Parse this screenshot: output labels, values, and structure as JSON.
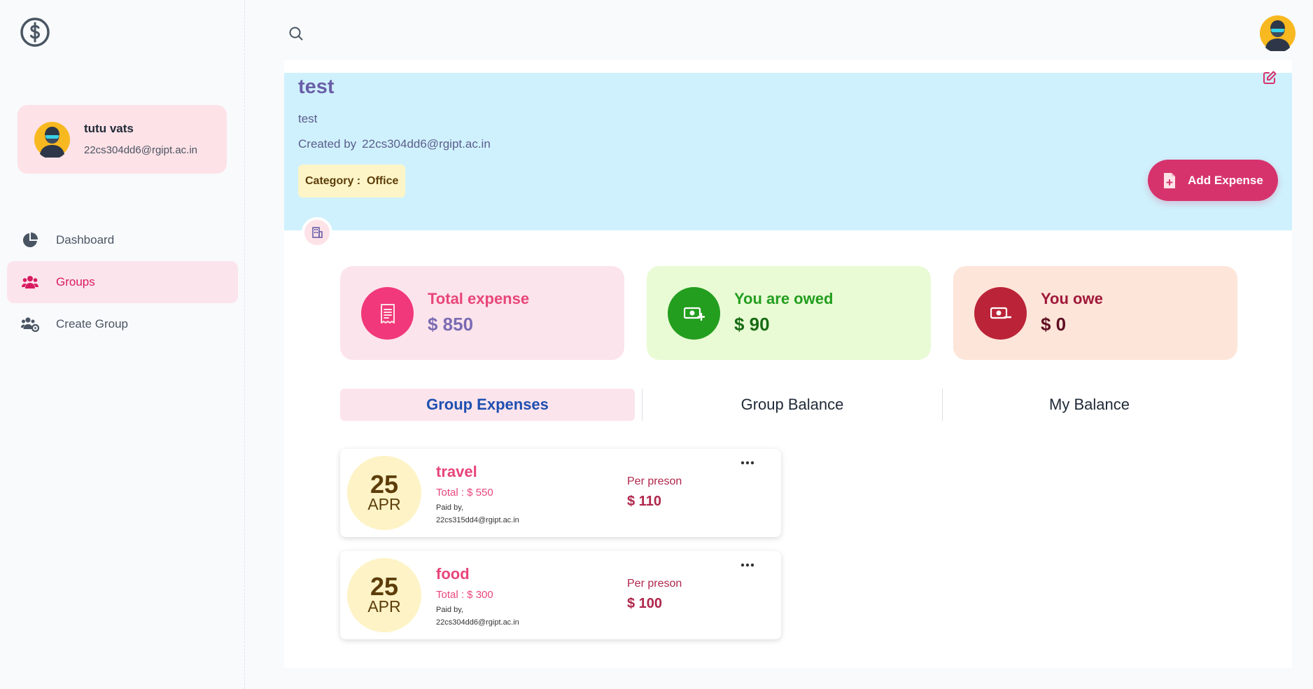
{
  "user": {
    "name": "tutu vats",
    "email": "22cs304dd6@rgipt.ac.in"
  },
  "nav": [
    {
      "label": "Dashboard",
      "icon": "pie-chart-icon"
    },
    {
      "label": "Groups",
      "icon": "users-icon",
      "active": true
    },
    {
      "label": "Create Group",
      "icon": "users-cog-icon"
    }
  ],
  "group": {
    "title": "test",
    "description": "test",
    "created_by_label": "Created by",
    "created_by": "22cs304dd6@rgipt.ac.in",
    "category_label": "Category :",
    "category": "Office",
    "add_expense_label": "Add Expense"
  },
  "stats": [
    {
      "label": "Total expense",
      "value": "$ 850",
      "icon": "receipt-icon"
    },
    {
      "label": "You are owed",
      "value": "$ 90",
      "icon": "money-plus-icon"
    },
    {
      "label": "You owe",
      "value": "$ 0",
      "icon": "money-minus-icon"
    }
  ],
  "tabs": [
    "Group Expenses",
    "Group Balance",
    "My Balance"
  ],
  "expenses": [
    {
      "day": "25",
      "month": "APR",
      "name": "travel",
      "total": "Total : $ 550",
      "paid_label": "Paid by,",
      "paid_by": "22cs315dd4@rgipt.ac.in",
      "per_label": "Per preson",
      "per_value": "$ 110"
    },
    {
      "day": "25",
      "month": "APR",
      "name": "food",
      "total": "Total : $ 300",
      "paid_label": "Paid by,",
      "paid_by": "22cs304dd6@rgipt.ac.in",
      "per_label": "Per preson",
      "per_value": "$ 100"
    }
  ],
  "colors": {
    "accent": "#d6336c",
    "hero_bg": "#cff1fd",
    "total_bg": "#fce4ec",
    "owed_bg": "#e9fbd5",
    "owe_bg": "#fde5d9"
  }
}
